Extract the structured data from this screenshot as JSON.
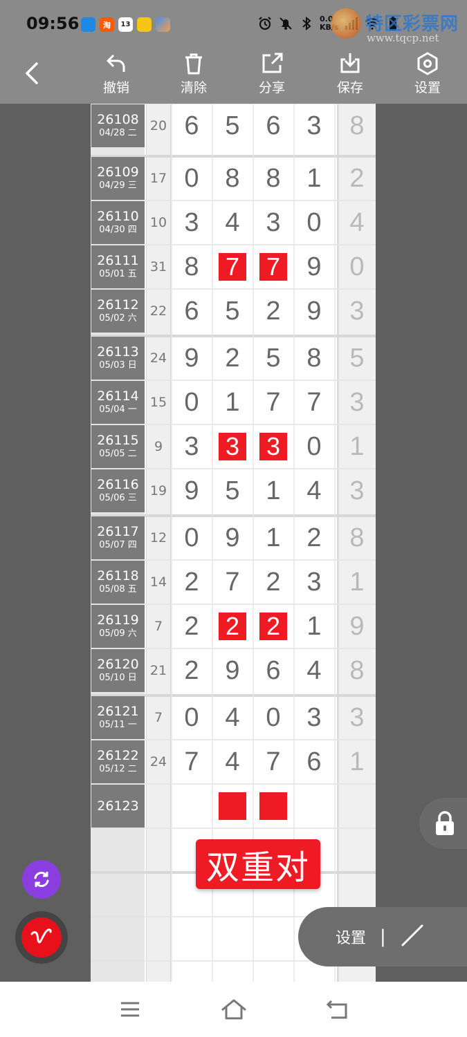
{
  "status_bar": {
    "time": "09:56",
    "net_speed_top": "0.0",
    "net_speed_bottom": "KB/s",
    "apps": [
      {
        "icon": "app-blue-icon",
        "label": "",
        "color": "#1e88e5"
      },
      {
        "icon": "taobao-icon",
        "label": "淘",
        "color": "#ff5a00"
      },
      {
        "icon": "calendar-icon",
        "label": "13",
        "color": "#ffffff"
      },
      {
        "icon": "app-yellow-icon",
        "label": "",
        "color": "#f5c518"
      },
      {
        "icon": "app-gradient-icon",
        "label": "",
        "color": "#4a8ef0"
      }
    ]
  },
  "watermark": {
    "title": "特区彩票网",
    "url": "www.tqcp.net"
  },
  "toolbar": {
    "undo_label": "撤销",
    "clear_label": "清除",
    "share_label": "分享",
    "save_label": "保存",
    "settings_label": "设置"
  },
  "rows": [
    {
      "issue": "26108",
      "date": "04/28 二",
      "sum": "20",
      "digits": [
        "6",
        "5",
        "6",
        "3"
      ],
      "last": "8",
      "hits": [
        false,
        false,
        false,
        false
      ]
    },
    {
      "issue": "26109",
      "date": "04/29 三",
      "sum": "17",
      "digits": [
        "0",
        "8",
        "8",
        "1"
      ],
      "last": "2",
      "hits": [
        false,
        false,
        false,
        false
      ]
    },
    {
      "issue": "26110",
      "date": "04/30 四",
      "sum": "10",
      "digits": [
        "3",
        "4",
        "3",
        "0"
      ],
      "last": "4",
      "hits": [
        false,
        false,
        false,
        false
      ]
    },
    {
      "issue": "26111",
      "date": "05/01 五",
      "sum": "31",
      "digits": [
        "8",
        "7",
        "7",
        "9"
      ],
      "last": "0",
      "hits": [
        false,
        true,
        true,
        false
      ]
    },
    {
      "issue": "26112",
      "date": "05/02 六",
      "sum": "22",
      "digits": [
        "6",
        "5",
        "2",
        "9"
      ],
      "last": "3",
      "hits": [
        false,
        false,
        false,
        false
      ]
    },
    {
      "issue": "26113",
      "date": "05/03 日",
      "sum": "24",
      "digits": [
        "9",
        "2",
        "5",
        "8"
      ],
      "last": "5",
      "hits": [
        false,
        false,
        false,
        false
      ]
    },
    {
      "issue": "26114",
      "date": "05/04 一",
      "sum": "15",
      "digits": [
        "0",
        "1",
        "7",
        "7"
      ],
      "last": "3",
      "hits": [
        false,
        false,
        false,
        false
      ]
    },
    {
      "issue": "26115",
      "date": "05/05 二",
      "sum": "9",
      "digits": [
        "3",
        "3",
        "3",
        "0"
      ],
      "last": "1",
      "hits": [
        false,
        true,
        true,
        false
      ]
    },
    {
      "issue": "26116",
      "date": "05/06 三",
      "sum": "19",
      "digits": [
        "9",
        "5",
        "1",
        "4"
      ],
      "last": "3",
      "hits": [
        false,
        false,
        false,
        false
      ]
    },
    {
      "issue": "26117",
      "date": "05/07 四",
      "sum": "12",
      "digits": [
        "0",
        "9",
        "1",
        "2"
      ],
      "last": "8",
      "hits": [
        false,
        false,
        false,
        false
      ]
    },
    {
      "issue": "26118",
      "date": "05/08 五",
      "sum": "14",
      "digits": [
        "2",
        "7",
        "2",
        "3"
      ],
      "last": "1",
      "hits": [
        false,
        false,
        false,
        false
      ]
    },
    {
      "issue": "26119",
      "date": "05/09 六",
      "sum": "7",
      "digits": [
        "2",
        "2",
        "2",
        "1"
      ],
      "last": "9",
      "hits": [
        false,
        true,
        true,
        false
      ]
    },
    {
      "issue": "26120",
      "date": "05/10 日",
      "sum": "21",
      "digits": [
        "2",
        "9",
        "6",
        "4"
      ],
      "last": "8",
      "hits": [
        false,
        false,
        false,
        false
      ]
    },
    {
      "issue": "26121",
      "date": "05/11 一",
      "sum": "7",
      "digits": [
        "0",
        "4",
        "0",
        "3"
      ],
      "last": "3",
      "hits": [
        false,
        false,
        false,
        false
      ]
    },
    {
      "issue": "26122",
      "date": "05/12 二",
      "sum": "24",
      "digits": [
        "7",
        "4",
        "7",
        "6"
      ],
      "last": "1",
      "hits": [
        false,
        false,
        false,
        false
      ]
    },
    {
      "issue": "26123",
      "date": "",
      "sum": "",
      "digits": [
        "",
        "",
        "",
        ""
      ],
      "last": "",
      "hits": [
        false,
        true,
        true,
        false
      ]
    }
  ],
  "stamp_text": "双重对",
  "float_panel": {
    "settings_label": "设置",
    "separator": "|"
  },
  "colors": {
    "highlight": "#ee1b24",
    "purple_button": "#8a3ee0",
    "pen_button": "#e8101a"
  }
}
